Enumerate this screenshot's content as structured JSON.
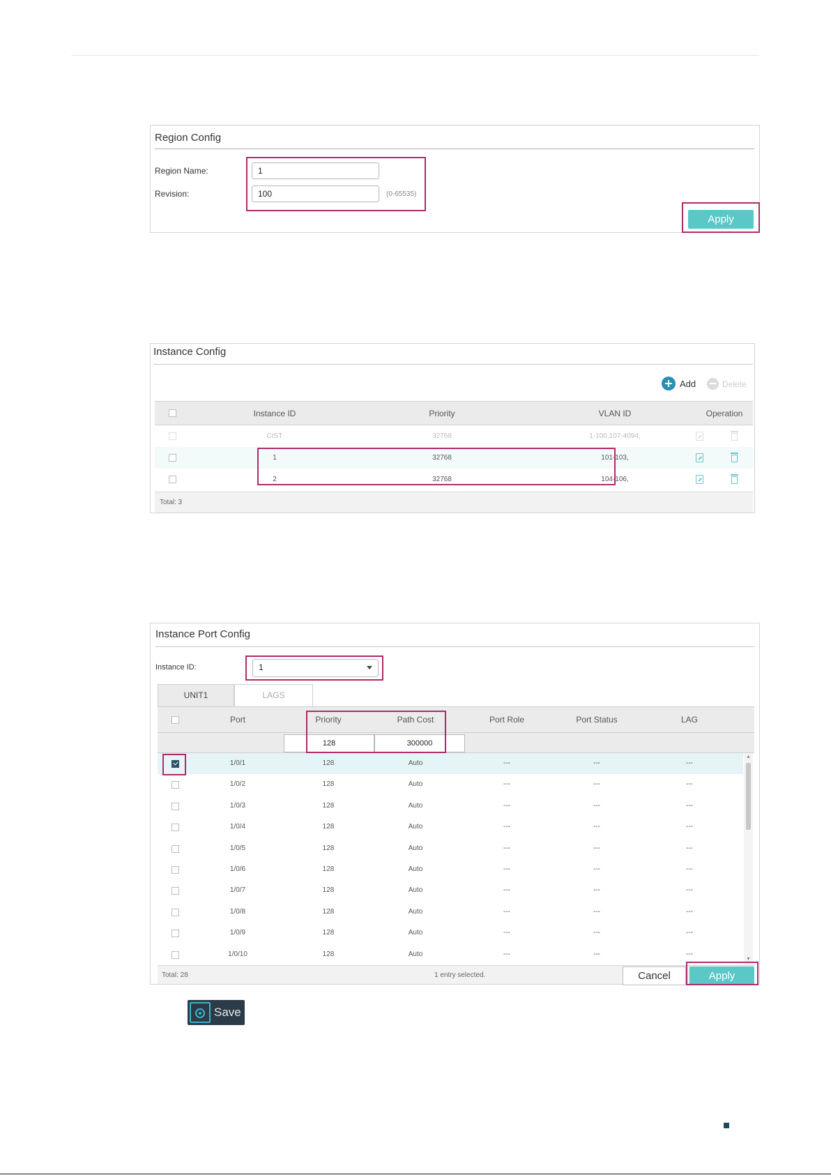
{
  "region_config": {
    "title": "Region Config",
    "region_name_label": "Region Name:",
    "region_name_value": "1",
    "revision_label": "Revision:",
    "revision_value": "100",
    "revision_hint": "(0-65535)",
    "apply_label": "Apply"
  },
  "instance_config": {
    "title": "Instance Config",
    "add_label": "Add",
    "delete_label": "Delete",
    "columns": [
      "Instance ID",
      "Priority",
      "VLAN ID",
      "Operation"
    ],
    "rows": [
      {
        "id": "CIST",
        "priority": "32768",
        "vlan": "1-100,107-4094,"
      },
      {
        "id": "1",
        "priority": "32768",
        "vlan": "101-103,"
      },
      {
        "id": "2",
        "priority": "32768",
        "vlan": "104-106,"
      }
    ],
    "total": "Total: 3"
  },
  "instance_port_config": {
    "title": "Instance Port Config",
    "instance_id_label": "Instance ID:",
    "instance_id_value": "1",
    "tabs": [
      "UNIT1",
      "LAGS"
    ],
    "columns": [
      "Port",
      "Priority",
      "Path Cost",
      "Port Role",
      "Port Status",
      "LAG"
    ],
    "edit_priority": "128",
    "edit_path_cost": "300000",
    "rows": [
      {
        "port": "1/0/1",
        "priority": "128",
        "path_cost": "Auto",
        "role": "---",
        "status": "---",
        "lag": "---"
      },
      {
        "port": "1/0/2",
        "priority": "128",
        "path_cost": "Auto",
        "role": "---",
        "status": "---",
        "lag": "---"
      },
      {
        "port": "1/0/3",
        "priority": "128",
        "path_cost": "Auto",
        "role": "---",
        "status": "---",
        "lag": "---"
      },
      {
        "port": "1/0/4",
        "priority": "128",
        "path_cost": "Auto",
        "role": "---",
        "status": "---",
        "lag": "---"
      },
      {
        "port": "1/0/5",
        "priority": "128",
        "path_cost": "Auto",
        "role": "---",
        "status": "---",
        "lag": "---"
      },
      {
        "port": "1/0/6",
        "priority": "128",
        "path_cost": "Auto",
        "role": "---",
        "status": "---",
        "lag": "---"
      },
      {
        "port": "1/0/7",
        "priority": "128",
        "path_cost": "Auto",
        "role": "---",
        "status": "---",
        "lag": "---"
      },
      {
        "port": "1/0/8",
        "priority": "128",
        "path_cost": "Auto",
        "role": "---",
        "status": "---",
        "lag": "---"
      },
      {
        "port": "1/0/9",
        "priority": "128",
        "path_cost": "Auto",
        "role": "---",
        "status": "---",
        "lag": "---"
      },
      {
        "port": "1/0/10",
        "priority": "128",
        "path_cost": "Auto",
        "role": "---",
        "status": "---",
        "lag": "---"
      }
    ],
    "total": "Total: 28",
    "selected_text": "1 entry selected.",
    "cancel_label": "Cancel",
    "apply_label": "Apply"
  },
  "save": {
    "label": "Save",
    "icon": "save-gear-icon"
  },
  "colors": {
    "accent": "#5bc8c8",
    "highlight": "#b02a6b",
    "save_bg": "#2c3b48"
  }
}
